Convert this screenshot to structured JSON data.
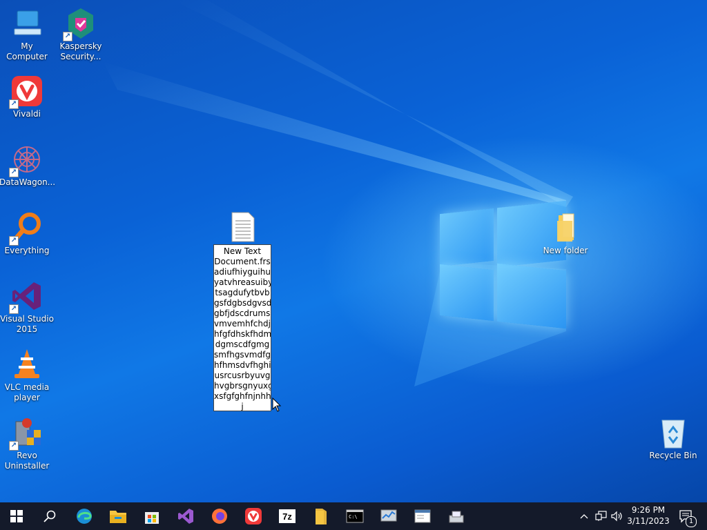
{
  "desktop": {
    "icons": [
      {
        "label": "My Computer",
        "icon": "computer-icon"
      },
      {
        "label": "Kaspersky Security...",
        "icon": "kaspersky-icon"
      },
      {
        "label": "Vivaldi",
        "icon": "vivaldi-icon"
      },
      {
        "label": "DataWagon...",
        "icon": "datawagon-icon"
      },
      {
        "label": "Everything",
        "icon": "everything-icon"
      },
      {
        "label": "Visual Studio 2015",
        "icon": "visual-studio-icon"
      },
      {
        "label": "VLC media player",
        "icon": "vlc-icon"
      },
      {
        "label": "Revo Uninstaller",
        "icon": "revo-icon"
      },
      {
        "label": "New folder",
        "icon": "folder-icon"
      },
      {
        "label": "Recycle Bin",
        "icon": "recycle-bin-icon"
      }
    ],
    "rename_lines": [
      "New Text",
      "Document.frs",
      "adiufhiyguihu",
      "yatvhreasuiby",
      "tsagdufytbvb",
      "gsfdgbsdgvsd",
      "gbfjdscdrumsi",
      "vmvemhfchdj",
      "hfgfdhskfhdm",
      "dgmscdfgmg",
      "smfhgsvmdfg",
      "hfhmsdvfhghi",
      "usrcusrbyuvg",
      "hvgbrsgnyuxg",
      "xsfgfghfnjnhh",
      "j"
    ]
  },
  "taskbar": {
    "buttons": [
      "start-icon",
      "search-icon",
      "edge-icon",
      "file-explorer-icon",
      "store-icon",
      "visual-studio-icon",
      "firefox-icon",
      "vivaldi-icon",
      "7zip-icon",
      "folder-icon",
      "terminal-icon",
      "task-manager-icon",
      "notepad-icon",
      "network-tool-icon"
    ],
    "clock_time": "9:26 PM",
    "clock_date": "3/11/2023",
    "notification_count": "1"
  },
  "colors": {
    "taskbar": "#141a2a",
    "wallpaper": "#0a5bc9"
  }
}
